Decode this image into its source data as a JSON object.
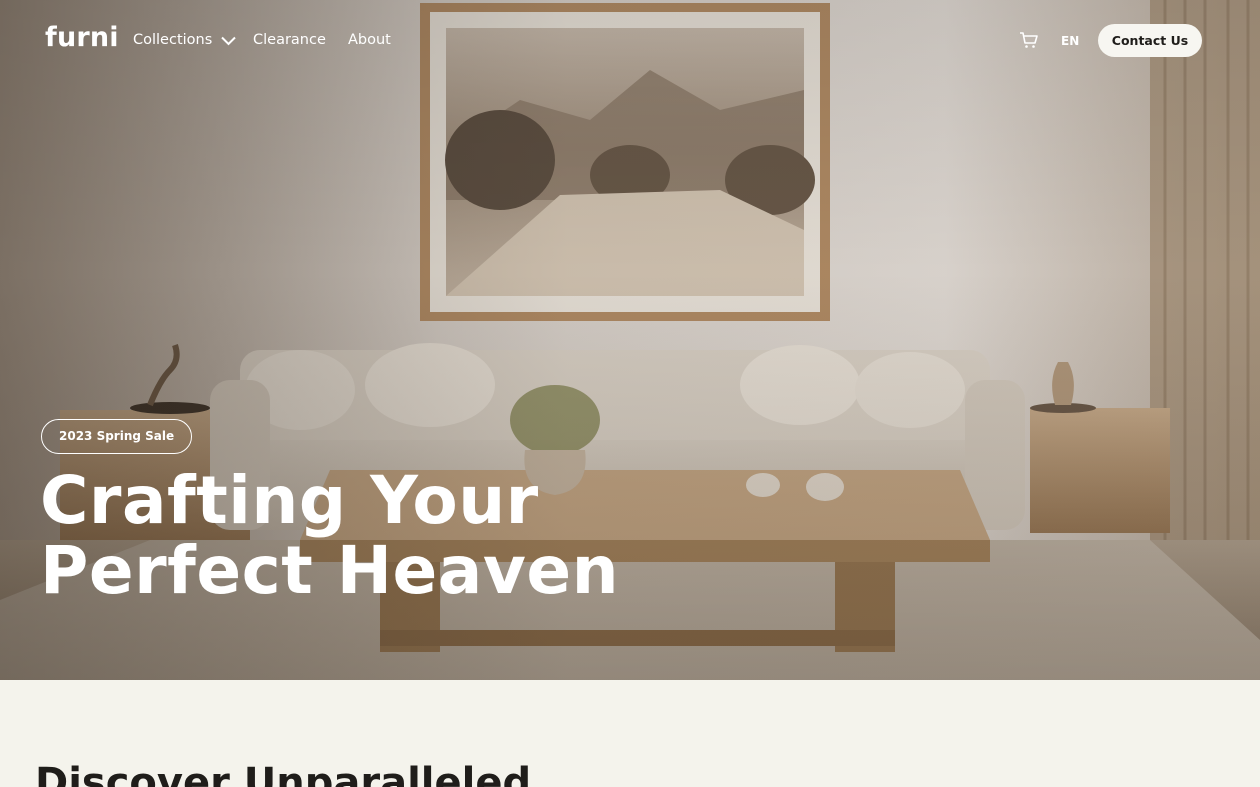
{
  "brand": {
    "logo_text": "furni"
  },
  "nav": {
    "links": [
      {
        "label": "Collections",
        "has_dropdown": true
      },
      {
        "label": "Clearance"
      },
      {
        "label": "About"
      }
    ],
    "language": "EN",
    "contact_label": "Contact Us"
  },
  "hero": {
    "badge": "2023 Spring Sale",
    "headline_line1": "Crafting Your",
    "headline_line2": "Perfect Heaven"
  },
  "section": {
    "title": "Discover Unparalleled"
  },
  "icons": {
    "nav_dropdown": "chevron-down-icon",
    "cart": "cart-icon"
  },
  "colors": {
    "button_bg": "#f7f6f1",
    "text_dark": "#1f1d1a",
    "page_bg": "#f4f3ec",
    "hero_text": "#ffffff"
  }
}
